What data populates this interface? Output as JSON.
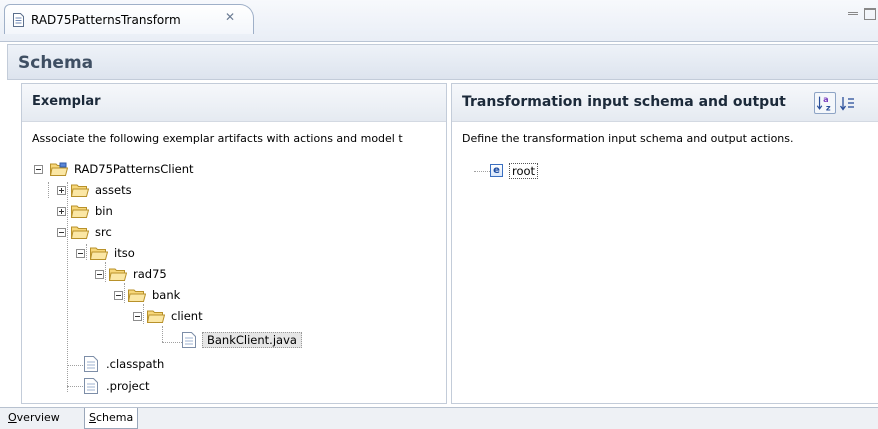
{
  "editor": {
    "tab_title": "RAD75PatternsTransform",
    "close_glyph": "✕"
  },
  "form": {
    "title": "Schema"
  },
  "exemplar": {
    "title": "Exemplar",
    "description": "Associate the following exemplar artifacts with actions and model t",
    "tree": [
      {
        "label": "RAD75PatternsClient",
        "type": "project",
        "expanded": true
      },
      {
        "label": "assets",
        "type": "folder",
        "expanded": false
      },
      {
        "label": "bin",
        "type": "folder",
        "expanded": false
      },
      {
        "label": "src",
        "type": "folder",
        "expanded": true
      },
      {
        "label": "itso",
        "type": "folder",
        "expanded": true
      },
      {
        "label": "rad75",
        "type": "folder",
        "expanded": true
      },
      {
        "label": "bank",
        "type": "folder",
        "expanded": true
      },
      {
        "label": "client",
        "type": "folder",
        "expanded": true
      },
      {
        "label": "BankClient.java",
        "type": "file",
        "selected": true
      },
      {
        "label": ".classpath",
        "type": "file"
      },
      {
        "label": ".project",
        "type": "file"
      }
    ]
  },
  "transformation": {
    "title": "Transformation input schema and output",
    "description": "Define the transformation input schema and output actions.",
    "root_icon_letter": "e",
    "root_label": "root"
  },
  "page_tabs": {
    "overview_mnemonic": "O",
    "overview_rest": "verview",
    "schema_mnemonic": "S",
    "schema_rest": "chema"
  }
}
